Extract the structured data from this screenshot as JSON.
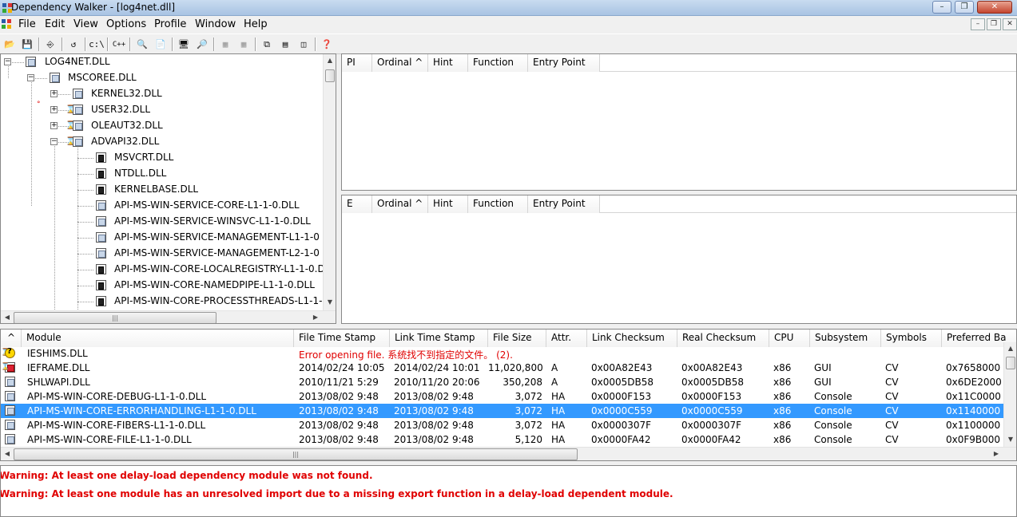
{
  "window": {
    "title": "Dependency Walker - [log4net.dll]",
    "minimize": "0",
    "maximize": "1",
    "close": "r"
  },
  "menu": {
    "items": [
      "File",
      "Edit",
      "View",
      "Options",
      "Profile",
      "Window",
      "Help"
    ]
  },
  "toolbar": {
    "labels": [
      "c:\\",
      "C++"
    ]
  },
  "tree": {
    "nodes": [
      {
        "label": "LOG4NET.DLL"
      },
      {
        "label": "MSCOREE.DLL"
      },
      {
        "label": "KERNEL32.DLL"
      },
      {
        "label": "USER32.DLL"
      },
      {
        "label": "OLEAUT32.DLL"
      },
      {
        "label": "ADVAPI32.DLL"
      },
      {
        "label": "MSVCRT.DLL"
      },
      {
        "label": "NTDLL.DLL"
      },
      {
        "label": "KERNELBASE.DLL"
      },
      {
        "label": "API-MS-WIN-SERVICE-CORE-L1-1-0.DLL"
      },
      {
        "label": "API-MS-WIN-SERVICE-WINSVC-L1-1-0.DLL"
      },
      {
        "label": "API-MS-WIN-SERVICE-MANAGEMENT-L1-1-0"
      },
      {
        "label": "API-MS-WIN-SERVICE-MANAGEMENT-L2-1-0"
      },
      {
        "label": "API-MS-WIN-CORE-LOCALREGISTRY-L1-1-0.D"
      },
      {
        "label": "API-MS-WIN-CORE-NAMEDPIPE-L1-1-0.DLL"
      },
      {
        "label": "API-MS-WIN-CORE-PROCESSTHREADS-L1-1-"
      }
    ]
  },
  "imports": {
    "columns": [
      "PI",
      "Ordinal ^",
      "Hint",
      "Function",
      "Entry Point"
    ]
  },
  "exports": {
    "columns": [
      "E",
      "Ordinal ^",
      "Hint",
      "Function",
      "Entry Point"
    ]
  },
  "modules": {
    "sort_indicator": "^",
    "columns": [
      "Module",
      "File Time Stamp",
      "Link Time Stamp",
      "File Size",
      "Attr.",
      "Link Checksum",
      "Real Checksum",
      "CPU",
      "Subsystem",
      "Symbols",
      "Preferred Ba"
    ],
    "error_row": {
      "module": "IESHIMS.DLL",
      "message": "Error opening file. 系统找不到指定的文件。 (2)."
    },
    "rows": [
      {
        "module": "IEFRAME.DLL",
        "file_ts": "2014/02/24 10:05",
        "link_ts": "2014/02/24 10:01",
        "size": "11,020,800",
        "attr": "A",
        "link_ck": "0x00A82E43",
        "real_ck": "0x00A82E43",
        "cpu": "x86",
        "subsystem": "GUI",
        "symbols": "CV",
        "base": "0x7658000"
      },
      {
        "module": "SHLWAPI.DLL",
        "file_ts": "2010/11/21  5:29",
        "link_ts": "2010/11/20 20:06",
        "size": "350,208",
        "attr": "A",
        "link_ck": "0x0005DB58",
        "real_ck": "0x0005DB58",
        "cpu": "x86",
        "subsystem": "GUI",
        "symbols": "CV",
        "base": "0x6DE2000"
      },
      {
        "module": "API-MS-WIN-CORE-DEBUG-L1-1-0.DLL",
        "file_ts": "2013/08/02  9:48",
        "link_ts": "2013/08/02  9:48",
        "size": "3,072",
        "attr": "HA",
        "link_ck": "0x0000F153",
        "real_ck": "0x0000F153",
        "cpu": "x86",
        "subsystem": "Console",
        "symbols": "CV",
        "base": "0x11C0000"
      },
      {
        "module": "API-MS-WIN-CORE-ERRORHANDLING-L1-1-0.DLL",
        "file_ts": "2013/08/02  9:48",
        "link_ts": "2013/08/02  9:48",
        "size": "3,072",
        "attr": "HA",
        "link_ck": "0x0000C559",
        "real_ck": "0x0000C559",
        "cpu": "x86",
        "subsystem": "Console",
        "symbols": "CV",
        "base": "0x1140000"
      },
      {
        "module": "API-MS-WIN-CORE-FIBERS-L1-1-0.DLL",
        "file_ts": "2013/08/02  9:48",
        "link_ts": "2013/08/02  9:48",
        "size": "3,072",
        "attr": "HA",
        "link_ck": "0x0000307F",
        "real_ck": "0x0000307F",
        "cpu": "x86",
        "subsystem": "Console",
        "symbols": "CV",
        "base": "0x1100000"
      },
      {
        "module": "API-MS-WIN-CORE-FILE-L1-1-0.DLL",
        "file_ts": "2013/08/02  9:48",
        "link_ts": "2013/08/02  9:48",
        "size": "5,120",
        "attr": "HA",
        "link_ck": "0x0000FA42",
        "real_ck": "0x0000FA42",
        "cpu": "x86",
        "subsystem": "Console",
        "symbols": "CV",
        "base": "0x0F9B000"
      }
    ],
    "selected_row": 3
  },
  "log": {
    "lines": [
      "Warning: At least one delay-load dependency module was not found.",
      "Warning: At least one module has an unresolved import due to a missing export function in a delay-load dependent module."
    ]
  },
  "colors": {
    "selection": "#3399ff",
    "error_text": "#e00000"
  }
}
